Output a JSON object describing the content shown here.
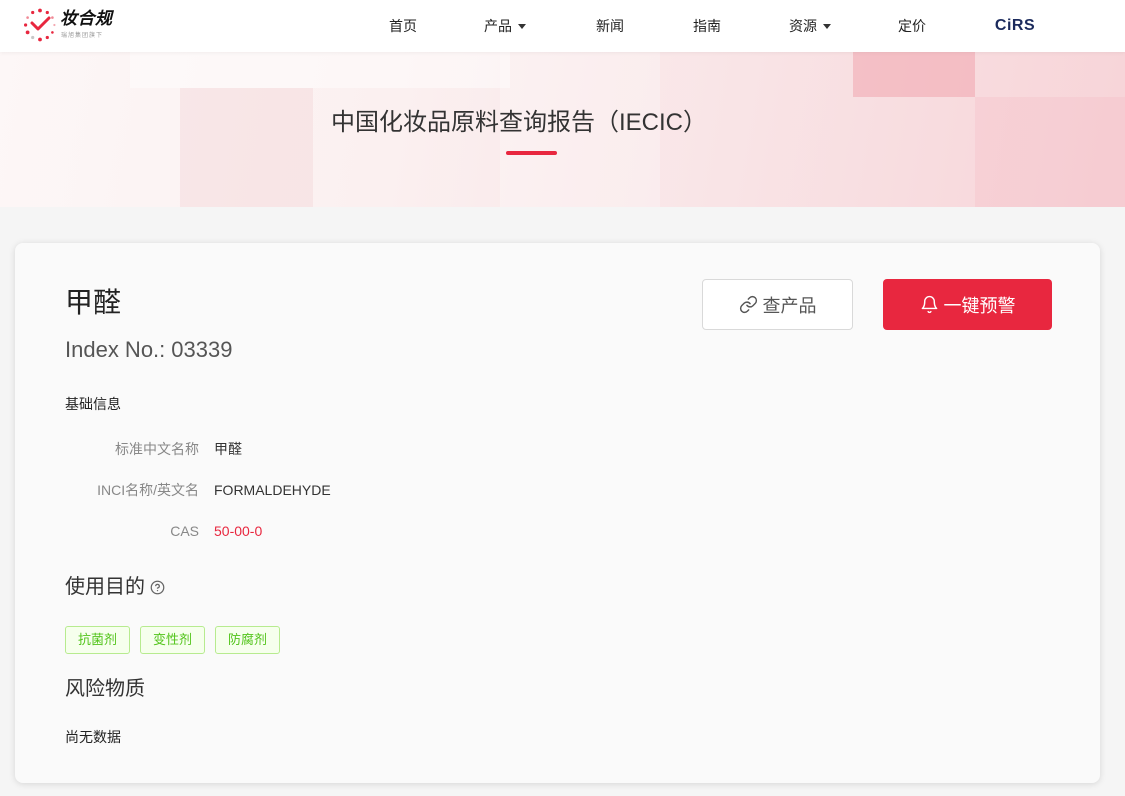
{
  "header": {
    "logo": {
      "name": "妆合规",
      "tagline": "瑞旭集团旗下"
    },
    "nav": [
      {
        "label": "首页",
        "dropdown": false
      },
      {
        "label": "产品",
        "dropdown": true
      },
      {
        "label": "新闻",
        "dropdown": false
      },
      {
        "label": "指南",
        "dropdown": false
      },
      {
        "label": "资源",
        "dropdown": true
      },
      {
        "label": "定价",
        "dropdown": false
      }
    ],
    "brand": "CiRS"
  },
  "hero": {
    "title": "中国化妆品原料查询报告（IECIC）"
  },
  "ingredient": {
    "name": "甲醛",
    "index_label": "Index No.:",
    "index_no": "03339",
    "actions": {
      "search_products": "查产品",
      "alert": "一键预警"
    },
    "basic_info": {
      "title": "基础信息",
      "fields": [
        {
          "label": "标准中文名称",
          "value": "甲醛"
        },
        {
          "label": "INCI名称/英文名",
          "value": "FORMALDEHYDE"
        },
        {
          "label": "CAS",
          "value": "50-00-0"
        }
      ]
    },
    "purpose": {
      "title": "使用目的",
      "tags": [
        "抗菌剂",
        "变性剂",
        "防腐剂"
      ]
    },
    "risk": {
      "title": "风险物质",
      "empty_text": "尚无数据"
    }
  },
  "icons": {
    "logo": "logo-icon",
    "dropdown": "caret-down-icon",
    "search_products": "link-icon",
    "alert": "bell-icon",
    "purpose_help": "question-circle-icon"
  },
  "colors": {
    "accent": "#e8273f",
    "brand": "#1b2a5c",
    "tag_text": "#52c41a",
    "tag_bg": "#f6ffed",
    "tag_border": "#b7eb8f"
  }
}
